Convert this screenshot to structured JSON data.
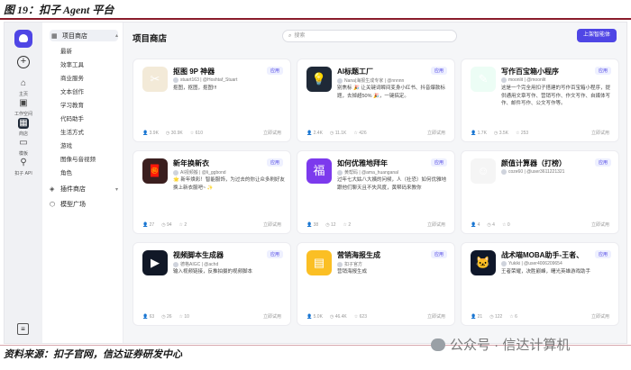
{
  "doc": {
    "title": "图 19：扣子 Agent 平台",
    "source": "资料来源：扣子官网，信达证券研发中心",
    "watermark": "公众号 · 信达计算机"
  },
  "rail": {
    "items": [
      {
        "label": "主页",
        "icon": "home-icon"
      },
      {
        "label": "工作空间",
        "icon": "workspace-icon"
      },
      {
        "label": "商店",
        "icon": "store-icon"
      },
      {
        "label": "模板",
        "icon": "template-icon"
      },
      {
        "label": "扣子 API",
        "icon": "api-icon"
      }
    ],
    "active": "商店"
  },
  "sidenav": {
    "group1": "项目商店",
    "items": [
      "最新",
      "效率工具",
      "商业服务",
      "文本创作",
      "学习教育",
      "代码助手",
      "生活方式",
      "游戏",
      "图像与音视频",
      "角色"
    ],
    "group2": "插件商店",
    "group3": "模型广场"
  },
  "main": {
    "title": "项目商店",
    "search_placeholder": "搜索",
    "publish_label": "上架智能体"
  },
  "cards": [
    {
      "title": "抠图 9P 神器",
      "tag": "应用",
      "author": "stuart163 | @Hoshtaf_Stuart",
      "desc": "抠图，抠图，抠图!!!",
      "stats": [
        "3.9K",
        "30.9K",
        "610"
      ],
      "try": "立即试用",
      "thumb_color": "#f3ead8",
      "thumb_glyph": "✂"
    },
    {
      "title": "AI标题工厂",
      "tag": "应用",
      "author": "Nana|海报生成专家 | @nnnnn",
      "desc": "别焦标 🎉 让关键词瞬间变身小红书、抖音爆款标题，去掉超50% 🎉，一键搞定。",
      "stats": [
        "2.4K",
        "11.1K",
        "426"
      ],
      "try": "立即试用",
      "thumb_color": "#1f2937",
      "thumb_glyph": "💡"
    },
    {
      "title": "写作百宝箱小程序",
      "tag": "应用",
      "author": "moonlit | @moonlit",
      "desc": "这是一个完全用扣子搭建的写作百宝箱小程序，提供通用文章写作、营销写作、作文写作、自媒体写作、邮件写作、公文写作等。",
      "stats": [
        "1.7K",
        "3.5K",
        "253"
      ],
      "try": "立即试用",
      "thumb_color": "#ecfdf5",
      "thumb_glyph": "✎"
    },
    {
      "title": "新年换新衣",
      "tag": "应用",
      "author": "AI视频搬 | @li_ggbond",
      "desc": "🌟 新年焕彩！智能服饰，为过去的你让众多刷好友换上新衣服吧~ ✨",
      "stats": [
        "27",
        "94",
        "2"
      ],
      "try": "立即试用",
      "thumb_color": "#3b1f1f",
      "thumb_glyph": "🧧"
    },
    {
      "title": "如何优雅地拜年",
      "tag": "应用",
      "author": "黄帮码 | @ama_huanganal",
      "desc": "过年七大姑八大姨的问候，人（社恐）如何优雅地跟他们聊天且不失风度，黄帮码来教你",
      "stats": [
        "38",
        "12",
        "2"
      ],
      "try": "立即试用",
      "thumb_color": "#7c3aed",
      "thumb_glyph": "福"
    },
    {
      "title": "颜值计算器（打榜）",
      "tag": "应用",
      "author": "coze60 | @user3611221321",
      "desc": "",
      "stats": [
        "4",
        "4",
        "0"
      ],
      "try": "立即试用",
      "thumb_color": "#f5f5f5",
      "thumb_glyph": "☺"
    },
    {
      "title": "视频脚本生成器",
      "tag": "应用",
      "author": "德格AIGC | @achd",
      "desc": "输入视频链接，反推拍摄的视频脚本",
      "stats": [
        "63",
        "26",
        "10"
      ],
      "try": "立即试用",
      "thumb_color": "#111827",
      "thumb_glyph": "▶"
    },
    {
      "title": "营销海报生成",
      "tag": "应用",
      "author": "扣子官方",
      "desc": "营销海报生成",
      "stats": [
        "5.0K",
        "46.4K",
        "623"
      ],
      "try": "立即试用",
      "thumb_color": "#fbbf24",
      "thumb_glyph": "▤"
    },
    {
      "title": "战术喵MOBA助手-王者、决胜巅峰",
      "tag": "应用",
      "author": "Yukiki | @user4006209654",
      "desc": "王者荣耀，决胜巅峰，曙光英雄游戏助手",
      "stats": [
        "21",
        "122",
        "6"
      ],
      "try": "立即试用",
      "thumb_color": "#0f172a",
      "thumb_glyph": "🐱"
    }
  ]
}
